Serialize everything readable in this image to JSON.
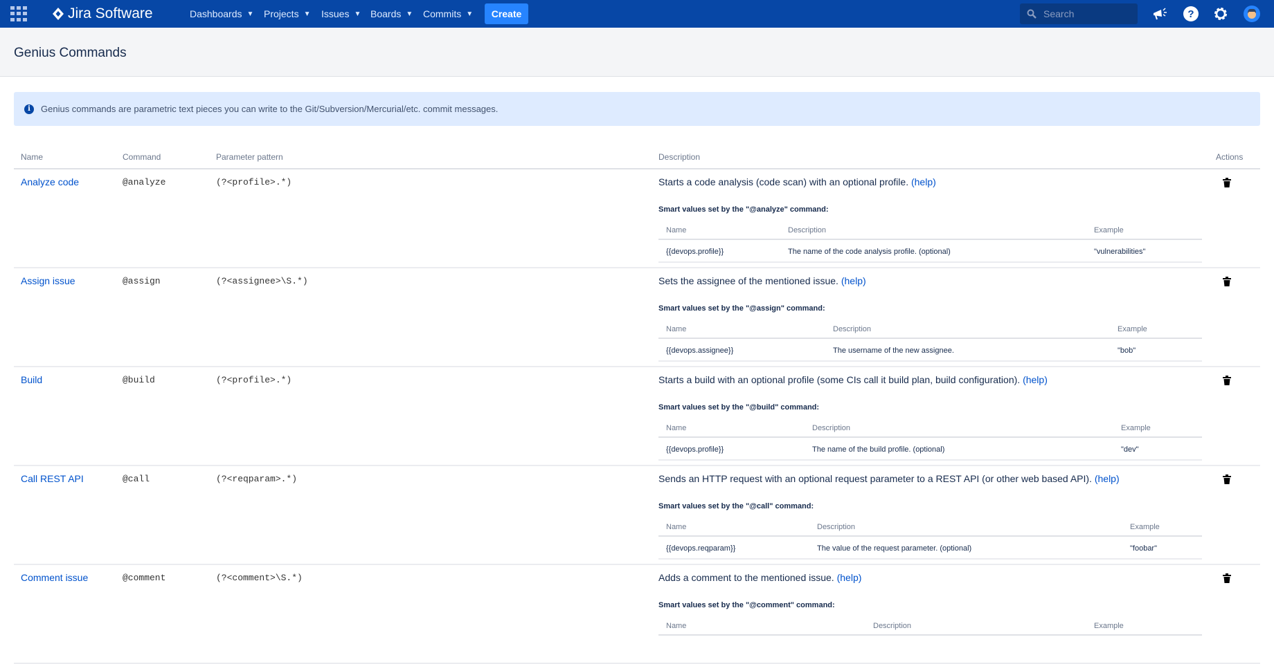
{
  "topbar": {
    "logo": "Jira Software",
    "nav": [
      {
        "label": "Dashboards"
      },
      {
        "label": "Projects"
      },
      {
        "label": "Issues"
      },
      {
        "label": "Boards"
      },
      {
        "label": "Commits"
      }
    ],
    "create_label": "Create",
    "search_placeholder": "Search"
  },
  "page": {
    "title": "Genius Commands",
    "info": "Genius commands are parametric text pieces you can write to the Git/Subversion/Mercurial/etc. commit messages."
  },
  "table": {
    "headers": {
      "name": "Name",
      "command": "Command",
      "pattern": "Parameter pattern",
      "description": "Description",
      "actions": "Actions"
    },
    "sub_headers": {
      "name": "Name",
      "description": "Description",
      "example": "Example"
    },
    "help_label": "(help)",
    "rows": [
      {
        "name": "Analyze code",
        "command": "@analyze",
        "pattern": "(?<profile>.*)",
        "description": "Starts a code analysis (code scan) with an optional profile.",
        "smart_label": "Smart values set by the \"@analyze\" command:",
        "smart": {
          "name": "{{devops.profile}}",
          "description": "The name of the code analysis profile. (optional)",
          "example": "\"vulnerabilities\""
        }
      },
      {
        "name": "Assign issue",
        "command": "@assign",
        "pattern": "(?<assignee>\\S.*)",
        "description": "Sets the assignee of the mentioned issue.",
        "smart_label": "Smart values set by the \"@assign\" command:",
        "smart": {
          "name": "{{devops.assignee}}",
          "description": "The username of the new assignee.",
          "example": "\"bob\""
        }
      },
      {
        "name": "Build",
        "command": "@build",
        "pattern": "(?<profile>.*)",
        "description": "Starts a build with an optional profile (some CIs call it build plan, build configuration).",
        "smart_label": "Smart values set by the \"@build\" command:",
        "smart": {
          "name": "{{devops.profile}}",
          "description": "The name of the build profile. (optional)",
          "example": "\"dev\""
        }
      },
      {
        "name": "Call REST API",
        "command": "@call",
        "pattern": "(?<reqparam>.*)",
        "description": "Sends an HTTP request with an optional request parameter to a REST API (or other web based API).",
        "smart_label": "Smart values set by the \"@call\" command:",
        "smart": {
          "name": "{{devops.reqparam}}",
          "description": "The value of the request parameter. (optional)",
          "example": "\"foobar\""
        }
      },
      {
        "name": "Comment issue",
        "command": "@comment",
        "pattern": "(?<comment>\\S.*)",
        "description": "Adds a comment to the mentioned issue.",
        "smart_label": "Smart values set by the \"@comment\" command:"
      }
    ]
  },
  "colors": {
    "header": "#0747a6",
    "create": "#2684ff",
    "link": "#0052cc",
    "info_bg": "#deebff"
  }
}
